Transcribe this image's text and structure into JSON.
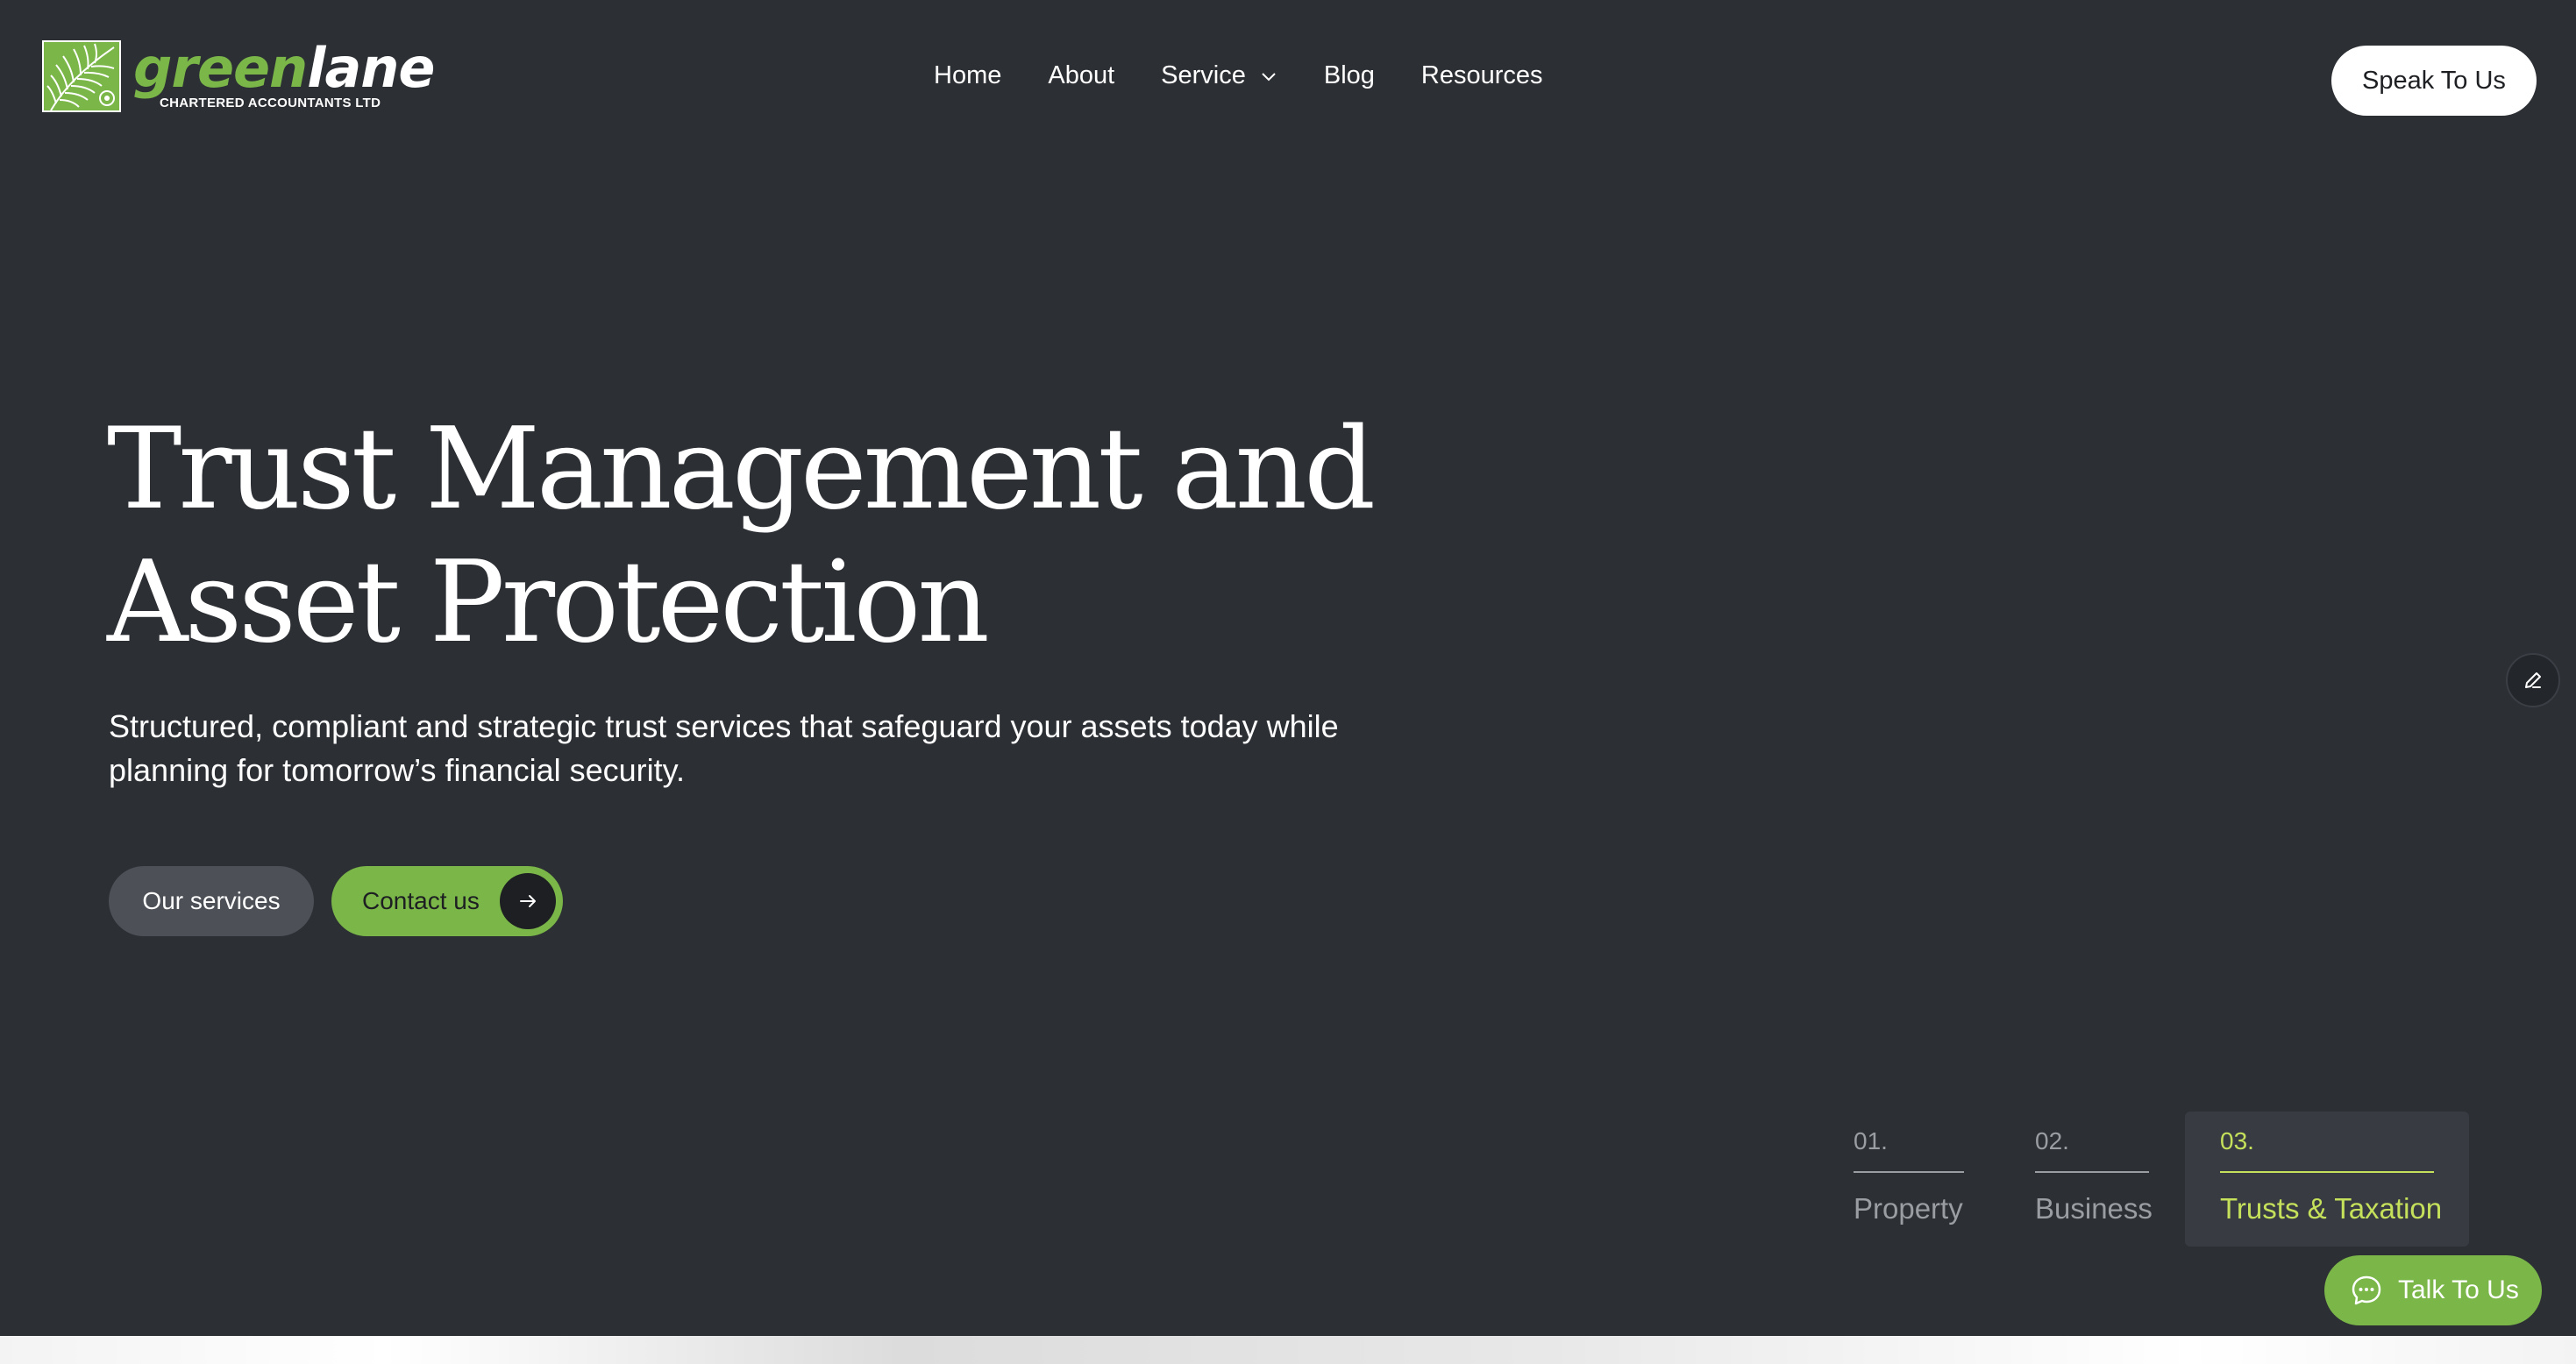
{
  "brand": {
    "name_part1": "green",
    "name_part2": "lane",
    "tagline": "CHARTERED ACCOUNTANTS LTD",
    "colors": {
      "accent": "#7ab648",
      "highlight": "#c5e05a",
      "background": "#2c2f34"
    }
  },
  "nav": {
    "items": [
      {
        "label": "Home"
      },
      {
        "label": "About"
      },
      {
        "label": "Service",
        "icon": "chevron-down-icon"
      },
      {
        "label": "Blog"
      },
      {
        "label": "Resources"
      }
    ]
  },
  "header": {
    "cta_label": "Speak To Us"
  },
  "hero": {
    "title_line1": "Trust Management and",
    "title_line2": "Asset Protection",
    "subtitle": "Structured, compliant and strategic trust services that safeguard your assets today while planning for tomorrow’s financial security.",
    "primary_button": "Our services",
    "secondary_button": "Contact us",
    "secondary_button_icon": "arrow-right-icon"
  },
  "tabs": [
    {
      "number": "01.",
      "label": "Property",
      "active": false
    },
    {
      "number": "02.",
      "label": "Business",
      "active": false
    },
    {
      "number": "03.",
      "label": "Trusts & Taxation",
      "active": true
    }
  ],
  "floating": {
    "edit_icon": "pencil-icon",
    "chat_label": "Talk To Us",
    "chat_icon": "chat-bubble-icon"
  }
}
